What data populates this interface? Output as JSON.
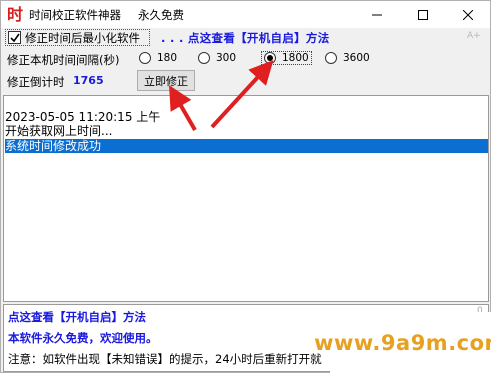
{
  "window": {
    "title": "时间校正软件神器",
    "subtitle": "永久免费",
    "icon_label": "时",
    "icons": {
      "minimize": "minimize-icon",
      "maximize": "maximize-icon",
      "close": "close-icon"
    }
  },
  "options": {
    "minimize_after_fix_label": "修正时间后最小化软件",
    "minimize_after_fix_checked": true,
    "autostart_link": ". . . 点这查看【开机自启】方法",
    "font_size_hint": "A+",
    "interval_label": "修正本机时间间隔(秒)",
    "interval_options": [
      {
        "label": "180",
        "selected": false
      },
      {
        "label": "300",
        "selected": false
      },
      {
        "label": "1800",
        "selected": true
      },
      {
        "label": "3600",
        "selected": false
      }
    ],
    "countdown_label": "修正倒计时",
    "countdown_value": "1765",
    "fix_now_button": "立即修正"
  },
  "log": {
    "lines": [
      "2023-05-05 11:20:15 上午",
      "开始获取网上时间..."
    ],
    "selected_line": "系统时间修改成功"
  },
  "bottom": {
    "autostart_link": "点这查看【开机自启】方法",
    "free_notice": "本软件永久免费，欢迎使用。",
    "note": "注意：如软件出现【未知错误】的提示，24小时后重新打开就",
    "scroll_marker": "0"
  },
  "watermark": {
    "text": "www.9a9m.com"
  },
  "colors": {
    "link_blue": "#1a1adf",
    "selection": "#0b6fd1",
    "arrow_red": "#e02020",
    "watermark_orange": "#e8a020",
    "icon_red": "#d42020"
  }
}
